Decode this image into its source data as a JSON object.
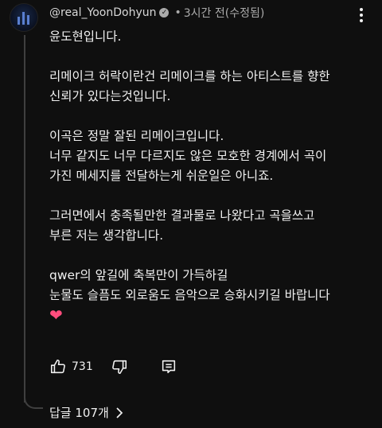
{
  "comment": {
    "author": "@real_YoonDohyun",
    "separator": "•",
    "time": "3시간 전(수정됨)",
    "lines": [
      "윤도현입니다.",
      "",
      "리메이크 허락이란건 리메이크를 하는 아티스트를 향한",
      "신뢰가 있다는것입니다.",
      "",
      "이곡은 정말 잘된 리메이크입니다.",
      "너무 같지도 너무 다르지도 않은 모호한 경계에서 곡이",
      "가진 메세지를 전달하는게 쉬운일은 아니죠.",
      "",
      "그러면에서 충족될만한 결과물로 나왔다고 곡을쓰고",
      "부른 저는 생각합니다.",
      "",
      "qwer의 앞길에 축복만이 가득하길",
      "눈물도 슬픔도 외로움도 음악으로 승화시키길 바랍니다"
    ],
    "emoji": "❤",
    "like_count": "731",
    "replies_label": "답글 107개"
  },
  "icons": {
    "avatar": "avatar",
    "verified": "verified-check-icon",
    "more": "more-vertical-icon",
    "like": "thumbs-up-icon",
    "dislike": "thumbs-down-icon",
    "reply": "reply-comment-icon",
    "chevron": "chevron-right-icon"
  }
}
